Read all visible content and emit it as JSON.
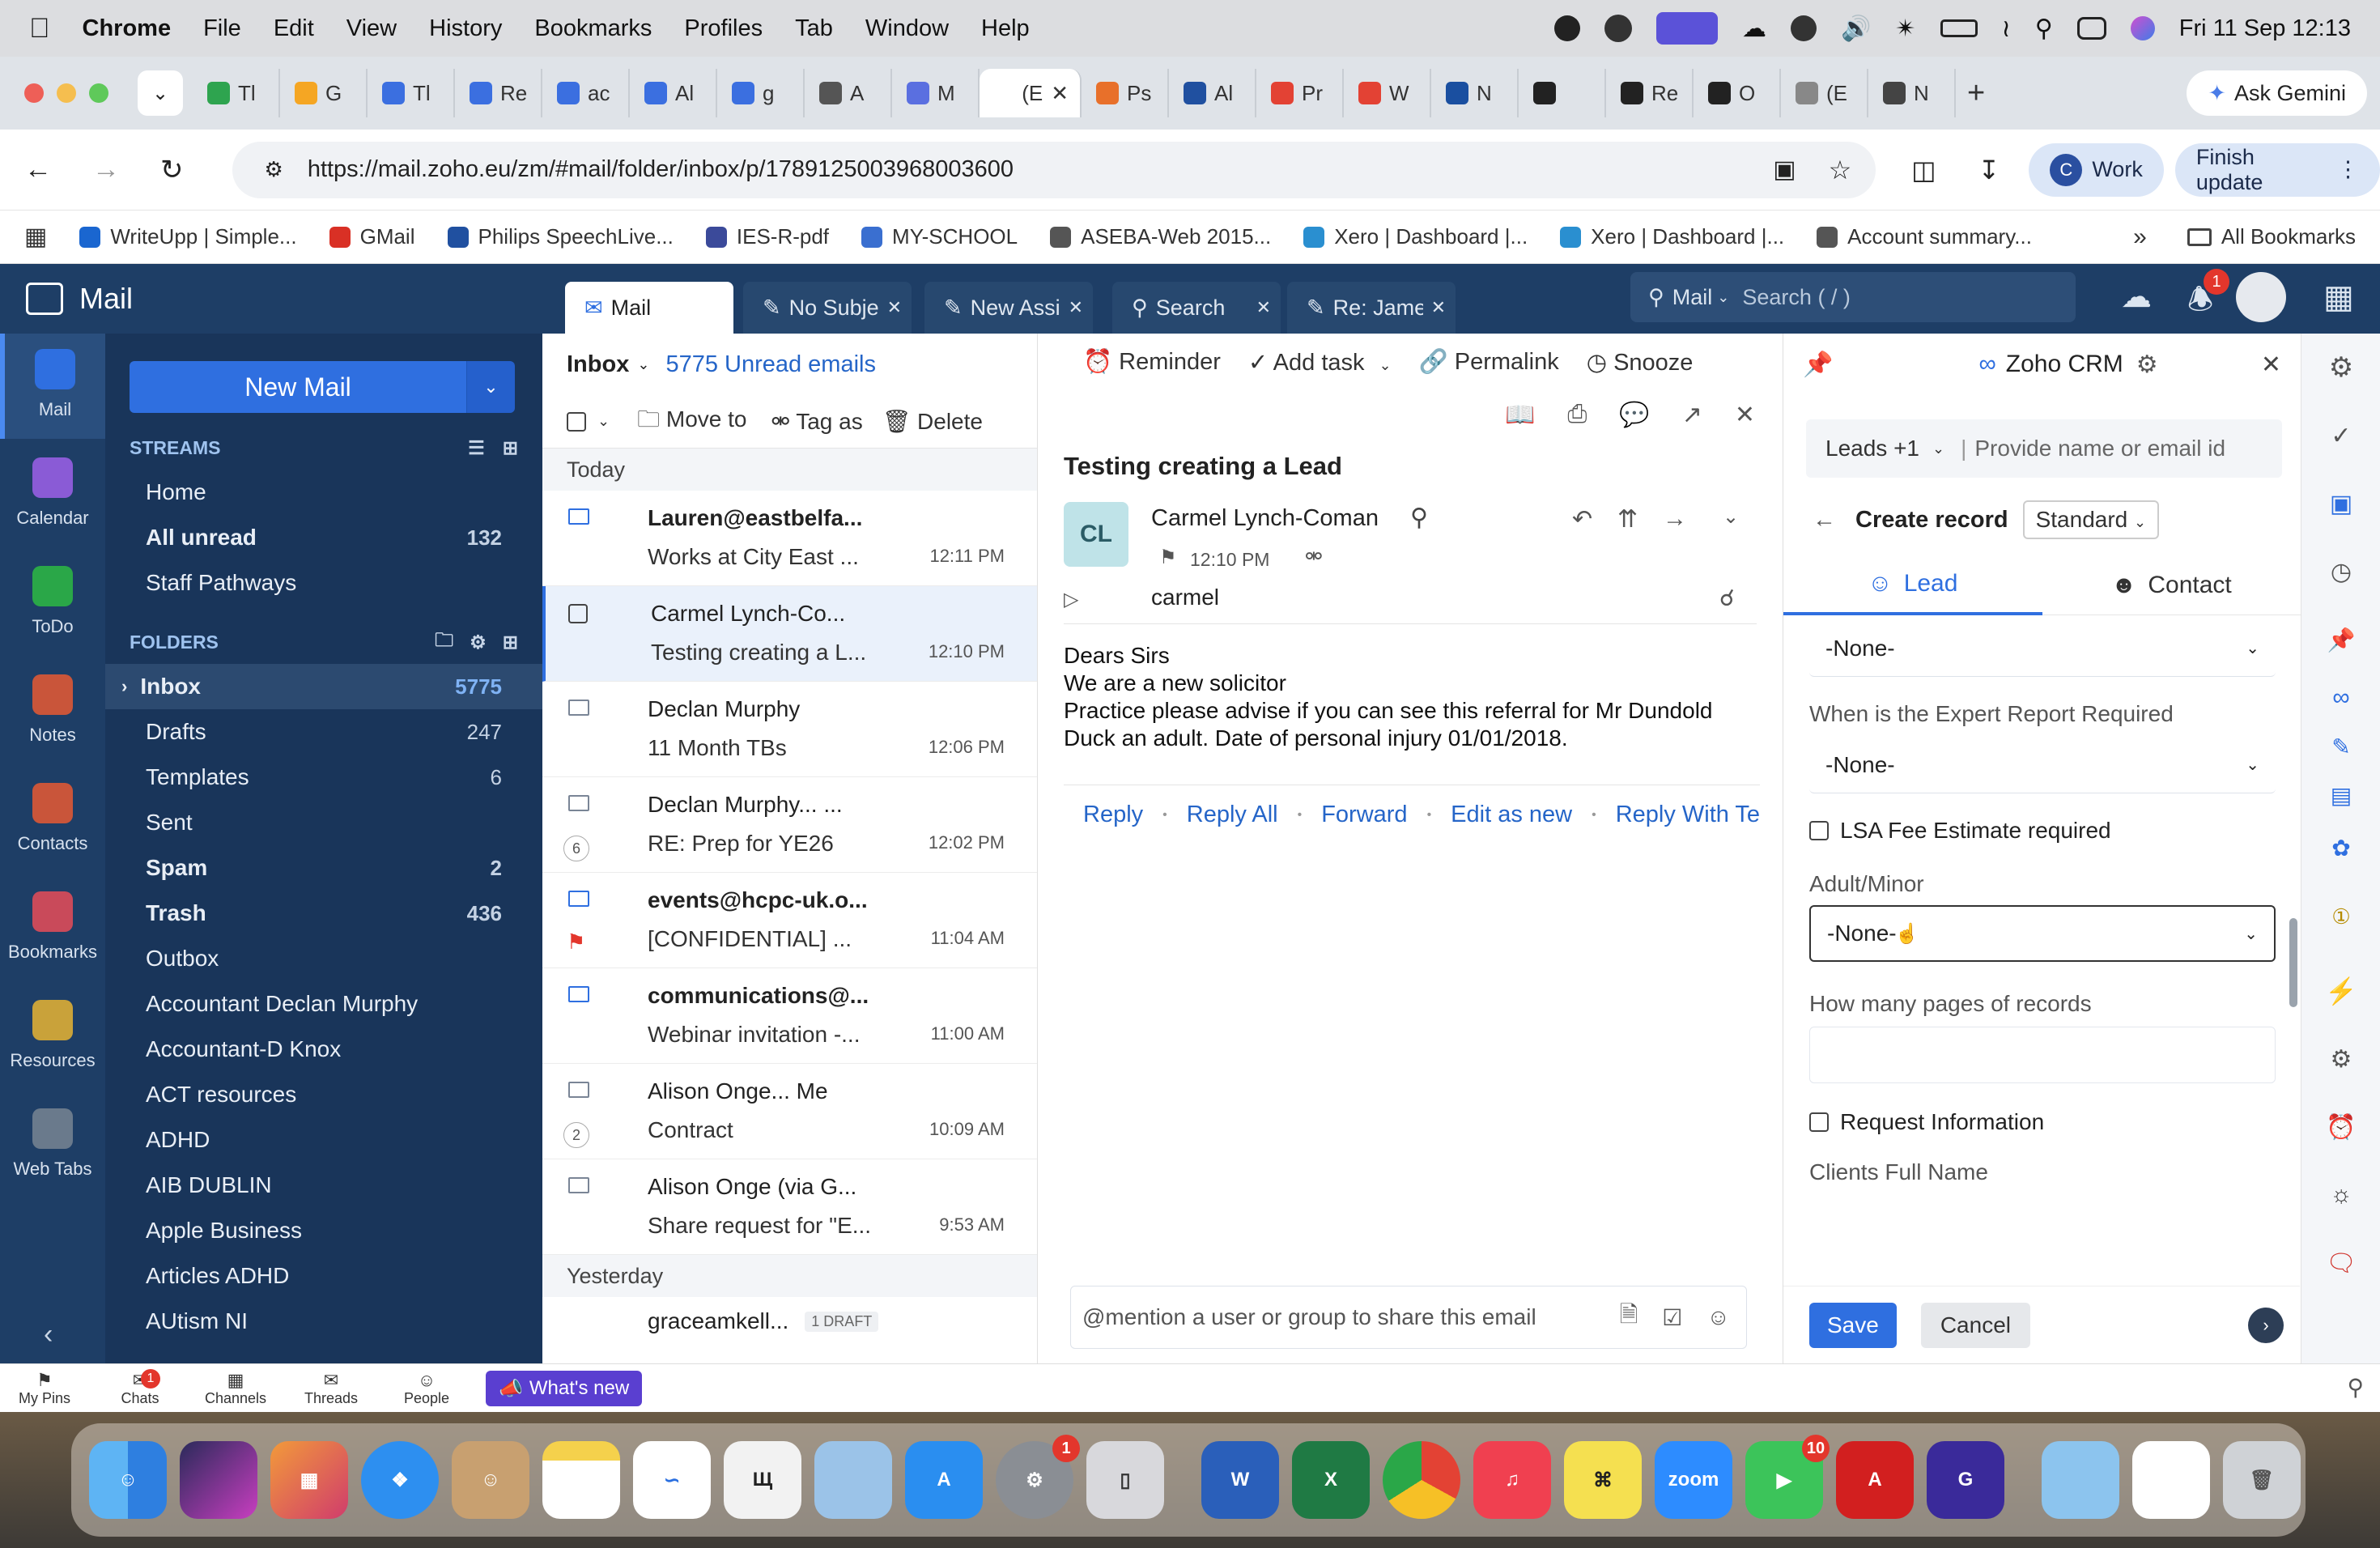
{
  "menubar": {
    "app": "Chrome",
    "items": [
      "File",
      "Edit",
      "View",
      "History",
      "Bookmarks",
      "Profiles",
      "Tab",
      "Window",
      "Help"
    ],
    "clock": "Fri 11 Sep  12:13"
  },
  "browser": {
    "tabs": [
      "Tl",
      "G",
      "Tl",
      "Re",
      "ac",
      "Al",
      "g",
      "A",
      "M",
      "(E",
      "Ps",
      "Al",
      "Pr",
      "W",
      "N",
      "",
      "Re",
      "O",
      "(E",
      "N"
    ],
    "ask_gemini": "Ask Gemini",
    "url": "https://mail.zoho.eu/zm/#mail/folder/inbox/p/1789125003968003600",
    "profile": "Work",
    "profile_initial": "C",
    "finish_update": "Finish update",
    "bookmarks": [
      "WriteUpp | Simple...",
      "GMail",
      "Philips SpeechLive...",
      "IES-R-pdf",
      "MY-SCHOOL",
      "ASEBA-Web 2015...",
      "Xero | Dashboard |...",
      "Xero | Dashboard |...",
      "Account summary..."
    ],
    "all_bookmarks": "All Bookmarks"
  },
  "zoho": {
    "app_title": "Mail",
    "apps": [
      "Mail",
      "Calendar",
      "ToDo",
      "Notes",
      "Contacts",
      "Bookmarks",
      "Resources",
      "Web Tabs"
    ],
    "new_mail": "New Mail",
    "streams_header": "STREAMS",
    "streams": [
      {
        "label": "Home",
        "count": ""
      },
      {
        "label": "All unread",
        "count": "132"
      },
      {
        "label": "Staff Pathways",
        "count": ""
      }
    ],
    "folders_header": "FOLDERS",
    "folders": [
      {
        "label": "Inbox",
        "count": "5775"
      },
      {
        "label": "Drafts",
        "count": "247"
      },
      {
        "label": "Templates",
        "count": "6"
      },
      {
        "label": "Sent",
        "count": ""
      },
      {
        "label": "Spam",
        "count": "2"
      },
      {
        "label": "Trash",
        "count": "436"
      },
      {
        "label": "Outbox",
        "count": ""
      },
      {
        "label": "Accountant Declan Murphy",
        "count": ""
      },
      {
        "label": "Accountant-D Knox",
        "count": ""
      },
      {
        "label": "ACT resources",
        "count": ""
      },
      {
        "label": "ADHD",
        "count": ""
      },
      {
        "label": "AIB DUBLIN",
        "count": ""
      },
      {
        "label": "Apple Business",
        "count": ""
      },
      {
        "label": "Articles ADHD",
        "count": ""
      },
      {
        "label": "AUtism NI",
        "count": ""
      }
    ],
    "tabs": [
      "Mail",
      "No Subje",
      "New Assi",
      "Search",
      "Re: James"
    ],
    "search_scope": "Mail",
    "search_placeholder": "Search ( / )",
    "notif_count": "1",
    "list": {
      "folder": "Inbox",
      "unread": "5775 Unread emails",
      "move_to": "Move to",
      "tag_as": "Tag as",
      "delete": "Delete",
      "today": "Today",
      "yesterday": "Yesterday",
      "rows": [
        {
          "from": "Lauren@eastbelfa...",
          "subject": "Works at City East ...",
          "time": "12:11 PM",
          "bold": true
        },
        {
          "from": "Carmel Lynch-Co...",
          "subject": "Testing creating a L...",
          "time": "12:10 PM",
          "bold": false
        },
        {
          "from": "Declan Murphy",
          "subject": "11 Month TBs",
          "time": "12:06 PM",
          "bold": false
        },
        {
          "from": "Declan Murphy... ...",
          "subject": "RE: Prep for YE26",
          "time": "12:02 PM",
          "bold": false,
          "thread": "6"
        },
        {
          "from": "events@hcpc-uk.o...",
          "subject": "[CONFIDENTIAL] ...",
          "time": "11:04 AM",
          "bold": true
        },
        {
          "from": "communications@...",
          "subject": "Webinar invitation -...",
          "time": "11:00 AM",
          "bold": true
        },
        {
          "from": "Alison Onge... Me",
          "subject": "Contract",
          "time": "10:09 AM",
          "bold": false,
          "thread": "2"
        },
        {
          "from": "Alison Onge (via G...",
          "subject": "Share request for \"E...",
          "time": "9:53 AM",
          "bold": false
        }
      ],
      "last_from": "graceamkell...",
      "draft_tag": "1 DRAFT"
    },
    "reader": {
      "reminder": "Reminder",
      "add_task": "Add task",
      "permalink": "Permalink",
      "snooze": "Snooze",
      "subject": "Testing creating a Lead",
      "initials": "CL",
      "sender": "Carmel Lynch-Coman",
      "time": "12:10 PM",
      "to": "carmel",
      "body": [
        "Dears Sirs",
        "We are a new solicitor",
        "Practice please advise if you can see this referral for Mr Dundold",
        "Duck an adult.  Date of personal injury 01/01/2018."
      ],
      "actions": [
        "Reply",
        "Reply All",
        "Forward",
        "Edit as new",
        "Reply With Temp"
      ],
      "mention_placeholder": "@mention a user or group to share this email"
    },
    "crm": {
      "title": "Zoho CRM",
      "module": "Leads +1",
      "search_placeholder": "Provide name or email id",
      "create_record": "Create record",
      "layout": "Standard",
      "tab_lead": "Lead",
      "tab_contact": "Contact",
      "select1": "-None-",
      "expert_label": "When is the Expert Report Required",
      "select2": "-None-",
      "lsa_label": "LSA Fee Estimate required",
      "adult_label": "Adult/Minor",
      "select3": "-None-",
      "pages_label": "How many pages of records",
      "request_label": "Request Information",
      "clients_label": "Clients Full Name",
      "save": "Save",
      "cancel": "Cancel"
    },
    "bottom": [
      "My Pins",
      "Chats",
      "Channels",
      "Threads",
      "People"
    ],
    "chats_badge": "1",
    "whats_new": "What's new"
  },
  "dock": {
    "zoom_label": "zoom",
    "settings_badge": "1",
    "facetime_badge": "10"
  },
  "colors": {
    "accent": "#2f6fe0",
    "sidebar": "#19355a",
    "appbar": "#1e3e66"
  }
}
